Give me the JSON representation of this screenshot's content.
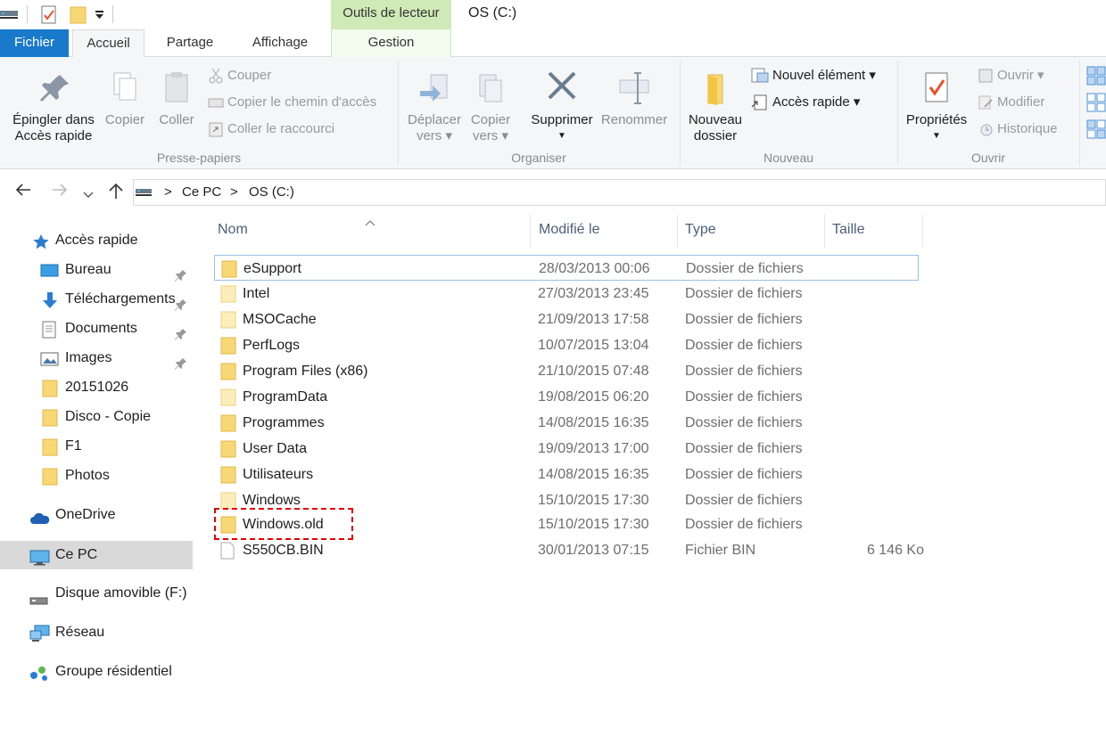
{
  "titlebar": {
    "context_tab_header": "Outils de lecteur",
    "window_title": "OS (C:)"
  },
  "tabs": {
    "fichier": "Fichier",
    "accueil": "Accueil",
    "partage": "Partage",
    "affichage": "Affichage",
    "gestion": "Gestion"
  },
  "ribbon": {
    "presse_papiers": {
      "group_label": "Presse-papiers",
      "epingler_l1": "Épingler dans",
      "epingler_l2": "Accès rapide",
      "copier": "Copier",
      "coller": "Coller",
      "couper": "Couper",
      "copier_chemin": "Copier le chemin d'accès",
      "coller_raccourci": "Coller le raccourci"
    },
    "organiser": {
      "group_label": "Organiser",
      "deplacer_l1": "Déplacer",
      "deplacer_l2": "vers ▾",
      "copier_vers_l1": "Copier",
      "copier_vers_l2": "vers ▾",
      "supprimer": "Supprimer",
      "renommer": "Renommer"
    },
    "nouveau": {
      "group_label": "Nouveau",
      "nouveau_dossier_l1": "Nouveau",
      "nouveau_dossier_l2": "dossier",
      "nouvel_element": "Nouvel élément ▾",
      "acces_rapide": "Accès rapide ▾"
    },
    "ouvrir": {
      "group_label": "Ouvrir",
      "proprietes": "Propriétés",
      "ouvrir": "Ouvrir ▾",
      "modifier": "Modifier",
      "historique": "Historique"
    }
  },
  "address": {
    "crumbs": [
      "Ce PC",
      "OS (C:)"
    ],
    "separator": ">"
  },
  "sidebar": {
    "items": [
      {
        "label": "Accès rapide"
      },
      {
        "label": "Bureau"
      },
      {
        "label": "Téléchargements"
      },
      {
        "label": "Documents"
      },
      {
        "label": "Images"
      },
      {
        "label": "20151026"
      },
      {
        "label": "Disco - Copie"
      },
      {
        "label": "F1"
      },
      {
        "label": "Photos"
      },
      {
        "label": "OneDrive"
      },
      {
        "label": "Ce PC"
      },
      {
        "label": "Disque amovible (F:)"
      },
      {
        "label": "Réseau"
      },
      {
        "label": "Groupe résidentiel"
      }
    ]
  },
  "filelist": {
    "columns": {
      "name": "Nom",
      "date": "Modifié le",
      "type": "Type",
      "size": "Taille"
    },
    "rows": [
      {
        "name": "eSupport",
        "date": "28/03/2013 00:06",
        "type": "Dossier de fichiers",
        "size": ""
      },
      {
        "name": "Intel",
        "date": "27/03/2013 23:45",
        "type": "Dossier de fichiers",
        "size": ""
      },
      {
        "name": "MSOCache",
        "date": "21/09/2013 17:58",
        "type": "Dossier de fichiers",
        "size": ""
      },
      {
        "name": "PerfLogs",
        "date": "10/07/2015 13:04",
        "type": "Dossier de fichiers",
        "size": ""
      },
      {
        "name": "Program Files (x86)",
        "date": "21/10/2015 07:48",
        "type": "Dossier de fichiers",
        "size": ""
      },
      {
        "name": "ProgramData",
        "date": "19/08/2015 06:20",
        "type": "Dossier de fichiers",
        "size": ""
      },
      {
        "name": "Programmes",
        "date": "14/08/2015 16:35",
        "type": "Dossier de fichiers",
        "size": ""
      },
      {
        "name": "User Data",
        "date": "19/09/2013 17:00",
        "type": "Dossier de fichiers",
        "size": ""
      },
      {
        "name": "Utilisateurs",
        "date": "14/08/2015 16:35",
        "type": "Dossier de fichiers",
        "size": ""
      },
      {
        "name": "Windows",
        "date": "15/10/2015 17:30",
        "type": "Dossier de fichiers",
        "size": ""
      },
      {
        "name": "Windows.old",
        "date": "15/10/2015 17:30",
        "type": "Dossier de fichiers",
        "size": ""
      },
      {
        "name": "S550CB.BIN",
        "date": "30/01/2013 07:15",
        "type": "Fichier BIN",
        "size": "6 146 Ko"
      }
    ]
  },
  "colors": {
    "accent": "#1979ca",
    "context_tab": "#cfe9b7",
    "folder": "#f8d775",
    "highlight": "#e00000"
  }
}
